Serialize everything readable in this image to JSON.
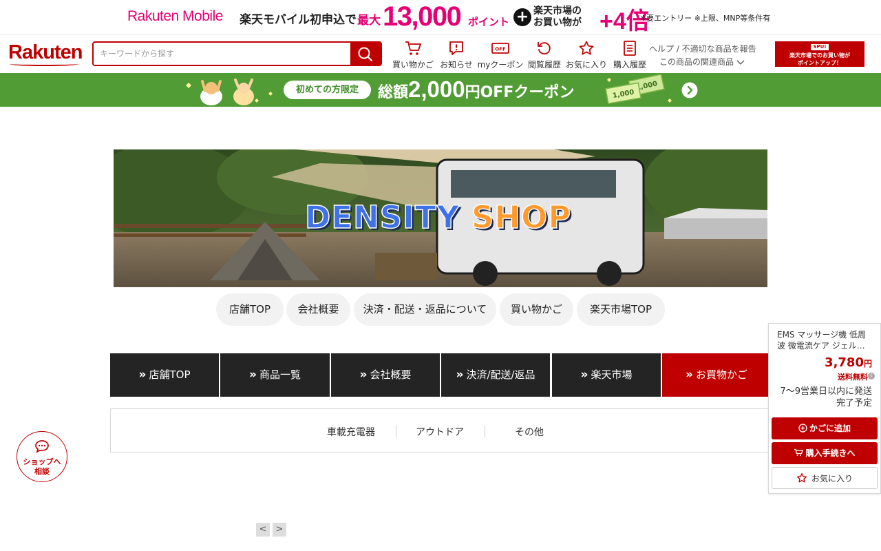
{
  "promo": {
    "brand_a": "Rakuten",
    "brand_b": " Mobile",
    "lead": "楽天モバイル初申込で",
    "max": "最大",
    "points_value": "13,000",
    "points_unit": "ポイント",
    "plus": "+",
    "market_line1": "楽天市場の",
    "market_line2": "お買い物が",
    "multiplier": "+4倍",
    "note": "※要エントリー ※上限、MNP等条件有"
  },
  "header": {
    "logo": "Rakuten",
    "search_placeholder": "キーワードから探す",
    "nav": [
      {
        "label": "買い物かご",
        "icon": "cart-icon"
      },
      {
        "label": "お知らせ",
        "icon": "notice-icon"
      },
      {
        "label": "myクーポン",
        "icon": "coupon-icon"
      },
      {
        "label": "閲覧履歴",
        "icon": "history-icon"
      },
      {
        "label": "お気に入り",
        "icon": "star-icon"
      },
      {
        "label": "購入履歴",
        "icon": "receipt-icon"
      }
    ],
    "coupon_icon_text": "OFF",
    "help_link": "ヘルプ / 不適切な商品を報告",
    "related_link": "この商品の関連商品",
    "spu_tag": "SPU!",
    "spu_line1": "楽天市場でのお買い物が",
    "spu_line2": "ポイントアップ！"
  },
  "coupon_banner": {
    "pill": "初めての方限定",
    "prefix": "総額",
    "amount": "2,000",
    "suffix": "円OFFクーポン",
    "bill_1": "1,000",
    "bill_2": "1,000"
  },
  "shop_banner": {
    "title_a": "DENSITY",
    "title_b": "SHOP"
  },
  "shop_tabs": [
    "店舗TOP",
    "会社概要",
    "決済・配送・返品について",
    "買い物かご",
    "楽天市場TOP"
  ],
  "dark_nav": [
    "店舗TOP",
    "商品一覧",
    "会社概要",
    "決済/配送/返品",
    "楽天市場",
    "お買物かご"
  ],
  "nav_chevron": "»",
  "categories": [
    "車載充電器",
    "アウトドア",
    "その他"
  ],
  "pager": {
    "prev": "<",
    "next": ">"
  },
  "chat": {
    "line1": "ショップへ",
    "line2": "相談"
  },
  "product_card": {
    "name": "EMS マッサージ機 低周波 微電流ケア ジェル…",
    "price": "3,780",
    "currency": "円",
    "shipping": "送料無料",
    "info": "i",
    "delivery": "7～9営業日以内に発送完了予定",
    "add_to_cart": "かごに追加",
    "checkout": "購入手続きへ",
    "favorite": "お気に入り"
  },
  "colors": {
    "brand_red": "#bf0000",
    "promo_pink": "#e60073",
    "coupon_green": "#519c34",
    "nav_dark": "#242424",
    "shop_blue": "#3f72e6",
    "shop_orange": "#ff9a2e"
  }
}
